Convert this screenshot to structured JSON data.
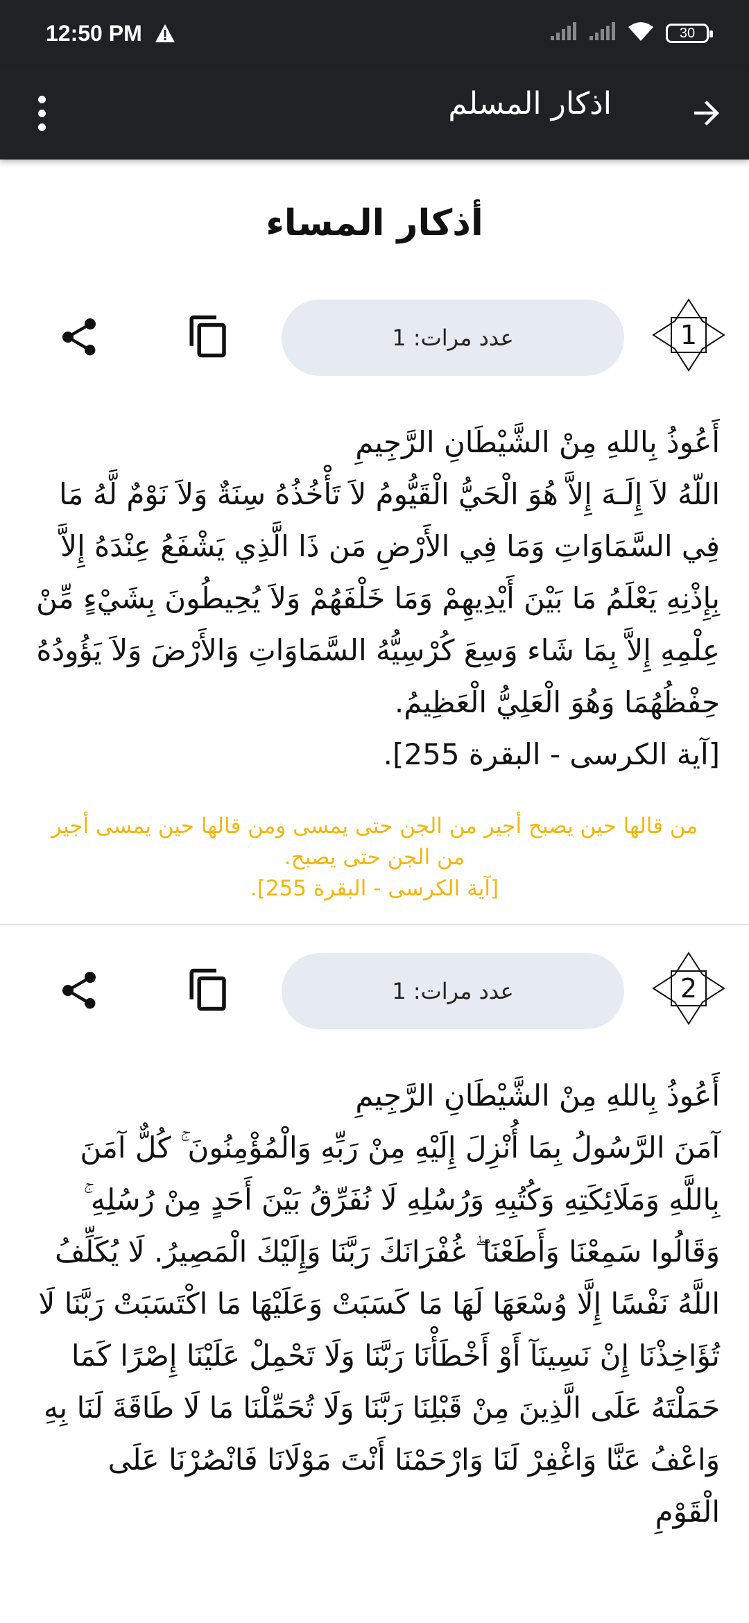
{
  "status": {
    "time": "12:50 PM",
    "battery": "30"
  },
  "appbar": {
    "title": "اذكار المسلم"
  },
  "page": {
    "title": "أذكار المساء"
  },
  "cards": [
    {
      "number": "1",
      "count_label": "عدد مرات: 1",
      "text": "أَعُوذُ بِاللهِ مِنْ الشَّيْطَانِ الرَّجِيمِ\nاللّهُ لاَ إِلَـهَ إِلاَّ هُوَ الْحَيُّ الْقَيُّومُ لاَ تَأْخُذُهُ سِنَةٌ وَلاَ نَوْمٌ لَّهُ مَا فِي السَّمَاوَاتِ وَمَا فِي الأَرْضِ مَن ذَا الَّذِي يَشْفَعُ عِنْدَهُ إِلاَّ بِإِذْنِهِ يَعْلَمُ مَا بَيْنَ أَيْدِيهِمْ وَمَا خَلْفَهُمْ وَلاَ يُحِيطُونَ بِشَيْءٍ مِّنْ عِلْمِهِ إِلاَّ بِمَا شَاء وَسِعَ كُرْسِيُّهُ السَّمَاوَاتِ وَالأَرْضَ وَلاَ يَؤُودُهُ حِفْظُهُمَا وَهُوَ الْعَلِيُّ الْعَظِيمُ.\n[آية الكرسى - البقرة 255].",
      "virtue": "من قالها حين يصبح أجير من الجن حتى يمسى ومن قالها حين يمسى أجير من الجن حتى يصبح.\n[آية الكرسى - البقرة 255]."
    },
    {
      "number": "2",
      "count_label": "عدد مرات: 1",
      "text": "أَعُوذُ بِاللهِ مِنْ الشَّيْطَانِ الرَّجِيمِ\nآمَنَ الرَّسُولُ بِمَا أُنْزِلَ إِلَيْهِ مِنْ رَبِّهِ وَالْمُؤْمِنُونَ ۚ كُلٌّ آمَنَ بِاللَّهِ وَمَلَائِكَتِهِ وَكُتُبِهِ وَرُسُلِهِ لَا نُفَرِّقُ بَيْنَ أَحَدٍ مِنْ رُسُلِهِ ۚ وَقَالُوا سَمِعْنَا وَأَطَعْنَا ۖ غُفْرَانَكَ رَبَّنَا وَإِلَيْكَ الْمَصِيرُ. لَا يُكَلِّفُ اللَّهُ نَفْسًا إِلَّا وُسْعَهَا لَهَا مَا كَسَبَتْ وَعَلَيْهَا مَا اكْتَسَبَتْ رَبَّنَا لَا تُؤَاخِذْنَا إِنْ نَسِينَآ أَوْ أَخْطَأْنَا رَبَّنَا وَلَا تَحْمِلْ عَلَيْنَا إِصْرًا كَمَا حَمَلْتَهُ عَلَى الَّذِينَ مِنْ قَبْلِنَا رَبَّنَا وَلَا تُحَمِّلْنَا مَا لَا طَاقَةَ لَنَا بِهِ وَاعْفُ عَنَّا وَاغْفِرْ لَنَا وَارْحَمْنَا أَنْتَ مَوْلَانَا فَانْصُرْنَا عَلَى الْقَوْمِ"
    }
  ],
  "icons": {
    "warning": "warning-icon",
    "signal": "signal-icon",
    "wifi": "wifi-icon",
    "menu": "more-vert-icon",
    "back": "arrow-forward-icon",
    "share": "share-icon",
    "copy": "copy-icon"
  },
  "colors": {
    "bar": "#202124",
    "pill": "#e6ebf2",
    "virtue": "#f2b60e"
  }
}
